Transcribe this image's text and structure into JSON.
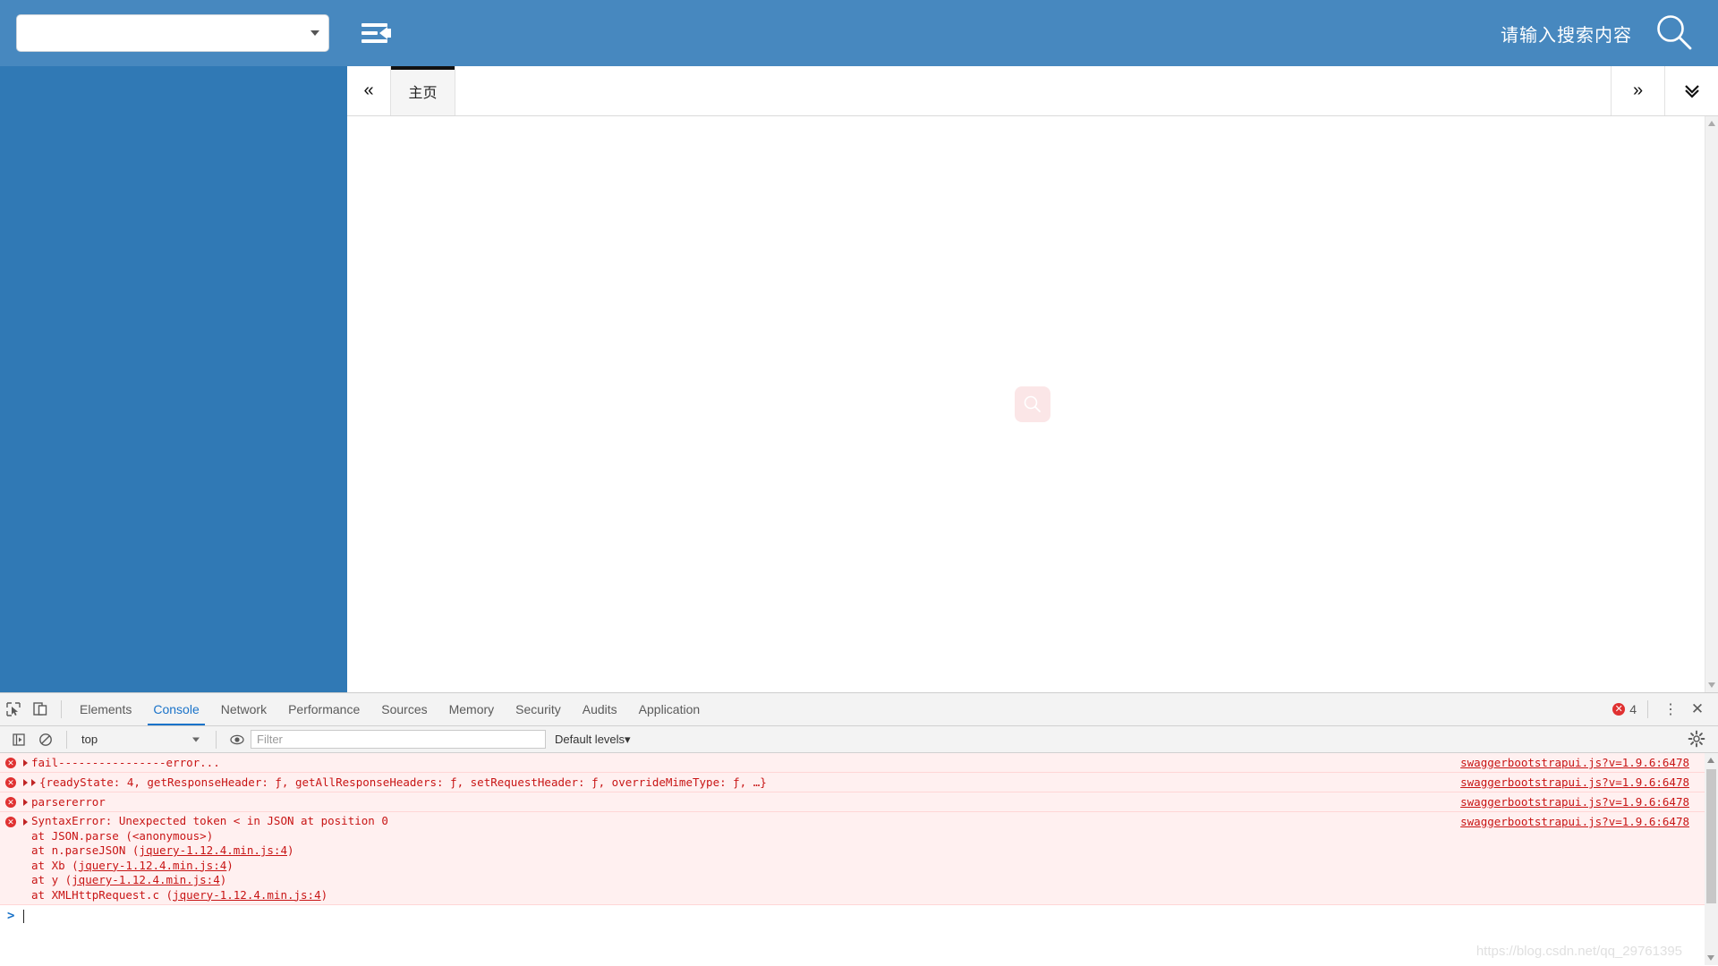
{
  "header": {
    "select_value": "",
    "select_caret_icon": "chevron-down-icon",
    "indent_icon": "indent-collapse-icon",
    "search_placeholder": "请输入搜索内容",
    "search_icon": "search-icon",
    "bg_color": "#4788bf"
  },
  "sidebar": {
    "bg_color": "#3079b5"
  },
  "tabstrip": {
    "prev_label": "«",
    "next_label": "»",
    "dropdown_label": "⌄",
    "tabs": [
      {
        "label": "主页",
        "active": true
      }
    ]
  },
  "content": {
    "empty_icon": "search-icon-placeholder",
    "empty_icon_bg": "#fbe6e7"
  },
  "devtools": {
    "inspect_icon": "inspect-element-icon",
    "device_icon": "device-toolbar-icon",
    "tabs": [
      {
        "label": "Elements",
        "active": false
      },
      {
        "label": "Console",
        "active": true
      },
      {
        "label": "Network",
        "active": false
      },
      {
        "label": "Performance",
        "active": false
      },
      {
        "label": "Sources",
        "active": false
      },
      {
        "label": "Memory",
        "active": false
      },
      {
        "label": "Security",
        "active": false
      },
      {
        "label": "Audits",
        "active": false
      },
      {
        "label": "Application",
        "active": false
      }
    ],
    "error_count": "4",
    "error_badge_glyph": "✕",
    "kebab_glyph": "⋮",
    "close_glyph": "✕",
    "accent_color": "#1a73c9",
    "error_color": "#e03131",
    "console": {
      "execute_icon": "execute-sidebar-icon",
      "clear_icon": "clear-console-icon",
      "context_value": "top",
      "eye_icon": "live-expression-icon",
      "filter_placeholder": "Filter",
      "filter_value": "",
      "levels_label": "Default levels",
      "levels_caret": "▾",
      "settings_icon": "gear-icon",
      "messages": [
        {
          "id": "msg-fail",
          "text": "fail----------------error...",
          "source": "swaggerbootstrapui.js?v=1.9.6:6478",
          "expandable": true,
          "type": "error"
        },
        {
          "id": "msg-xhr",
          "text": "{readyState: 4, getResponseHeader: ƒ, getAllResponseHeaders: ƒ, setRequestHeader: ƒ, overrideMimeType: ƒ, …}",
          "ready_state_value": "4",
          "source": "swaggerbootstrapui.js?v=1.9.6:6478",
          "expandable": true,
          "double_arrow": true,
          "type": "error"
        },
        {
          "id": "msg-parsererror",
          "text": "parsererror",
          "source": "swaggerbootstrapui.js?v=1.9.6:6478",
          "expandable": true,
          "type": "error"
        },
        {
          "id": "msg-syntaxerror",
          "text": "SyntaxError: Unexpected token < in JSON at position 0",
          "source": "swaggerbootstrapui.js?v=1.9.6:6478",
          "expandable": true,
          "type": "error",
          "stack": [
            {
              "prefix": "    at JSON.parse (",
              "link": "<anonymous>",
              "suffix": ")",
              "linked": false
            },
            {
              "prefix": "    at n.parseJSON (",
              "link": "jquery-1.12.4.min.js:4",
              "suffix": ")",
              "linked": true
            },
            {
              "prefix": "    at Xb (",
              "link": "jquery-1.12.4.min.js:4",
              "suffix": ")",
              "linked": true
            },
            {
              "prefix": "    at y (",
              "link": "jquery-1.12.4.min.js:4",
              "suffix": ")",
              "linked": true
            },
            {
              "prefix": "    at XMLHttpRequest.c (",
              "link": "jquery-1.12.4.min.js:4",
              "suffix": ")",
              "linked": true
            }
          ]
        }
      ],
      "prompt_glyph": ">"
    }
  },
  "watermark": "https://blog.csdn.net/qq_29761395"
}
